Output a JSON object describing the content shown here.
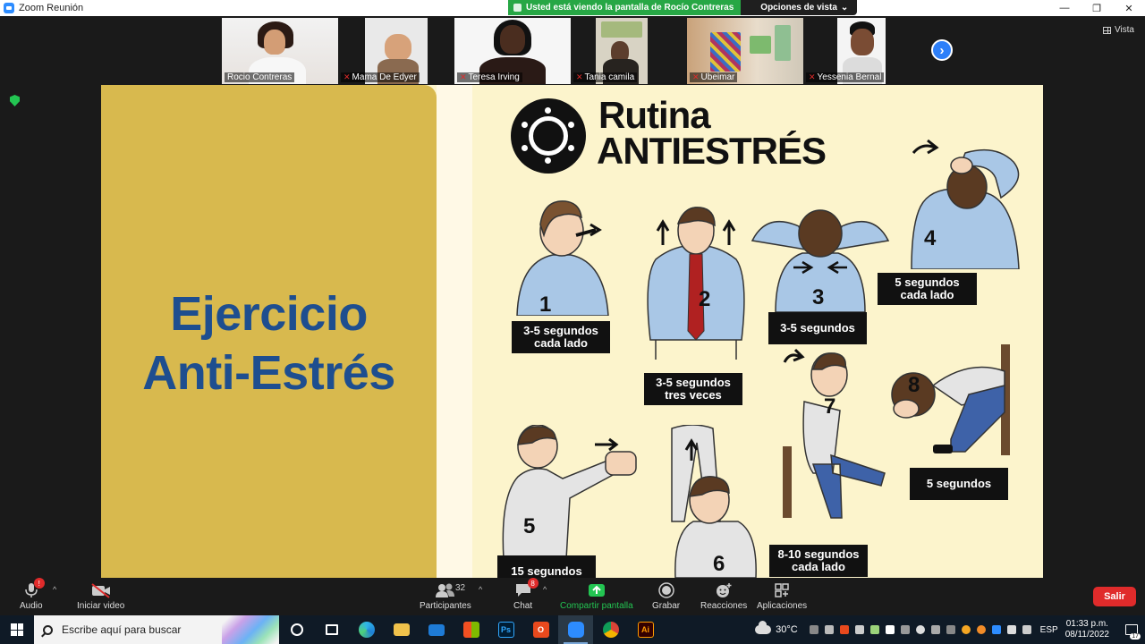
{
  "window": {
    "title": "Zoom Reunión",
    "minimize_glyph": "—",
    "maximize_glyph": "❐",
    "close_glyph": "✕"
  },
  "share_banner": {
    "message": "Usted está viendo la pantalla de Rocío Contreras",
    "view_options": "Opciones de vista",
    "chevron": "⌄"
  },
  "view_button": {
    "label": "Vista"
  },
  "participants_strip": [
    {
      "name": "Rocio Contreras",
      "muted": false,
      "active": true
    },
    {
      "name": "Mama De Edyer",
      "muted": true,
      "active": false
    },
    {
      "name": "Teresa Irving",
      "muted": true,
      "active": false
    },
    {
      "name": "Tania camila",
      "muted": true,
      "active": false
    },
    {
      "name": "Ubeimar",
      "muted": true,
      "active": false
    },
    {
      "name": "Yessenia Bernal",
      "muted": true,
      "active": false
    }
  ],
  "next_page_glyph": "›",
  "mute_glyph": "🎤̸",
  "slide": {
    "title_line1": "Ejercicio",
    "title_line2": "Anti-Estrés",
    "poster_title1": "Rutina",
    "poster_title2": "ANTIESTRÉS",
    "steps": [
      {
        "num": "1",
        "label": "3-5 segundos\ncada lado"
      },
      {
        "num": "2",
        "label": "3-5 segundos\ntres veces"
      },
      {
        "num": "3",
        "label": "3-5 segundos"
      },
      {
        "num": "4",
        "label": "5 segundos\ncada lado"
      },
      {
        "num": "5",
        "label": "15 segundos"
      },
      {
        "num": "6",
        "label": ""
      },
      {
        "num": "7",
        "label": "8-10 segundos\ncada lado"
      },
      {
        "num": "8",
        "label": "5 segundos"
      }
    ]
  },
  "toolbar": {
    "audio": {
      "label": "Audio",
      "badge": "!"
    },
    "video": {
      "label": "Iniciar video"
    },
    "participants": {
      "label": "Participantes",
      "count": "32"
    },
    "chat": {
      "label": "Chat",
      "badge": "8"
    },
    "share": {
      "label": "Compartir pantalla"
    },
    "record": {
      "label": "Grabar"
    },
    "reactions": {
      "label": "Reacciones"
    },
    "apps": {
      "label": "Aplicaciones"
    },
    "caret": "^",
    "leave": {
      "label": "Salir"
    }
  },
  "taskbar": {
    "search_placeholder": "Escribe aquí para buscar",
    "apps": [
      "cortana",
      "task-view",
      "edge",
      "file-explorer",
      "mail",
      "store",
      "photoshop",
      "office",
      "zoom",
      "chrome",
      "illustrator"
    ],
    "app_letters": {
      "photoshop": "Ps",
      "illustrator": "Ai",
      "office": "O"
    },
    "weather": "30°C",
    "language": "ESP",
    "time": "01:33 p.m.",
    "date": "08/11/2022",
    "notifications": "17"
  },
  "colors": {
    "slide_gold": "#d8b94e",
    "slide_title_blue": "#1e4e8f",
    "poster_bg": "#fcf4cc",
    "zoom_green": "#23c552",
    "leave_red": "#e02b2b"
  }
}
